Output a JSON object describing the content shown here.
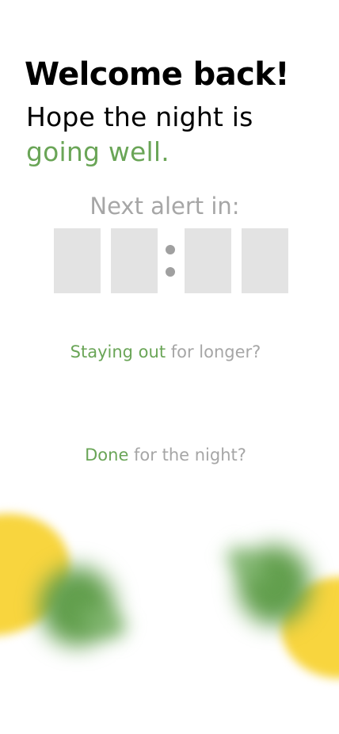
{
  "header": {
    "title": "Welcome back!",
    "subtitle_line1": "Hope the night is",
    "subtitle_line2": "going well."
  },
  "countdown": {
    "label": "Next alert in:",
    "separator": ":",
    "digits": [
      "",
      "",
      "",
      ""
    ]
  },
  "actions": {
    "staying_out": {
      "accent_text": "Staying out",
      "rest_text": " for longer?"
    },
    "done": {
      "accent_text": "Done",
      "rest_text": " for the night?"
    }
  },
  "colors": {
    "accent": "#6aa557",
    "muted": "#a6a6a6",
    "digit_box": "#e3e3e3",
    "decor_yellow": "#f8d53e",
    "decor_green": "#629f4d"
  }
}
